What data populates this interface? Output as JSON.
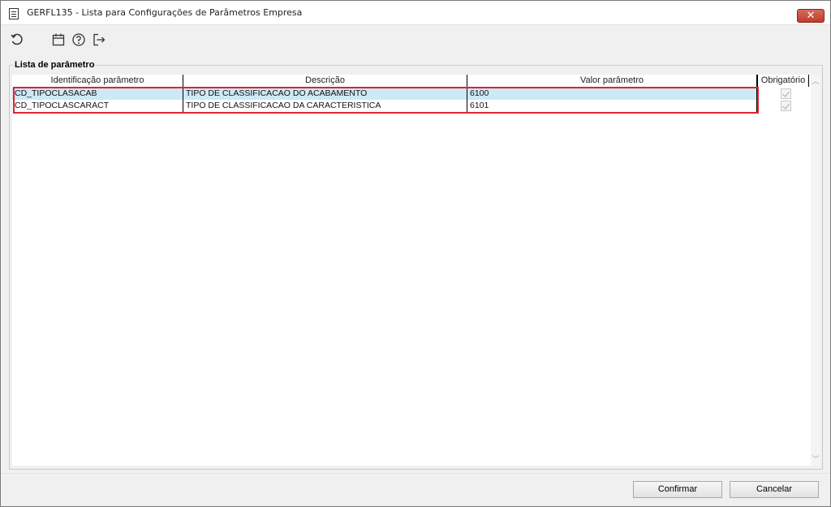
{
  "window": {
    "title": "GERFL135 - Lista para Configurações de Parâmetros Empresa",
    "close_label": "✕"
  },
  "toolbar": {
    "icons": [
      "refresh-icon",
      "calendar-icon",
      "help-icon",
      "exit-icon"
    ]
  },
  "group": {
    "legend": "Lista de parâmetro"
  },
  "grid": {
    "columns": [
      "Identificação parâmetro",
      "Descrição",
      "Valor parâmetro",
      "Obrigatório"
    ],
    "rows": [
      {
        "id": "CD_TIPOCLASACAB",
        "descricao": "TIPO DE CLASSIFICACAO DO ACABAMENTO",
        "valor": "6100",
        "obrigatorio": true
      },
      {
        "id": "CD_TIPOCLASCARACT",
        "descricao": "TIPO DE CLASSIFICACAO DA CARACTERISTICA",
        "valor": "6101",
        "obrigatorio": true
      }
    ]
  },
  "buttons": {
    "confirm": "Confirmar",
    "cancel": "Cancelar"
  },
  "colors": {
    "selection": "#cde8f7",
    "highlight": "#e0242c",
    "close": "#c13b2a"
  }
}
